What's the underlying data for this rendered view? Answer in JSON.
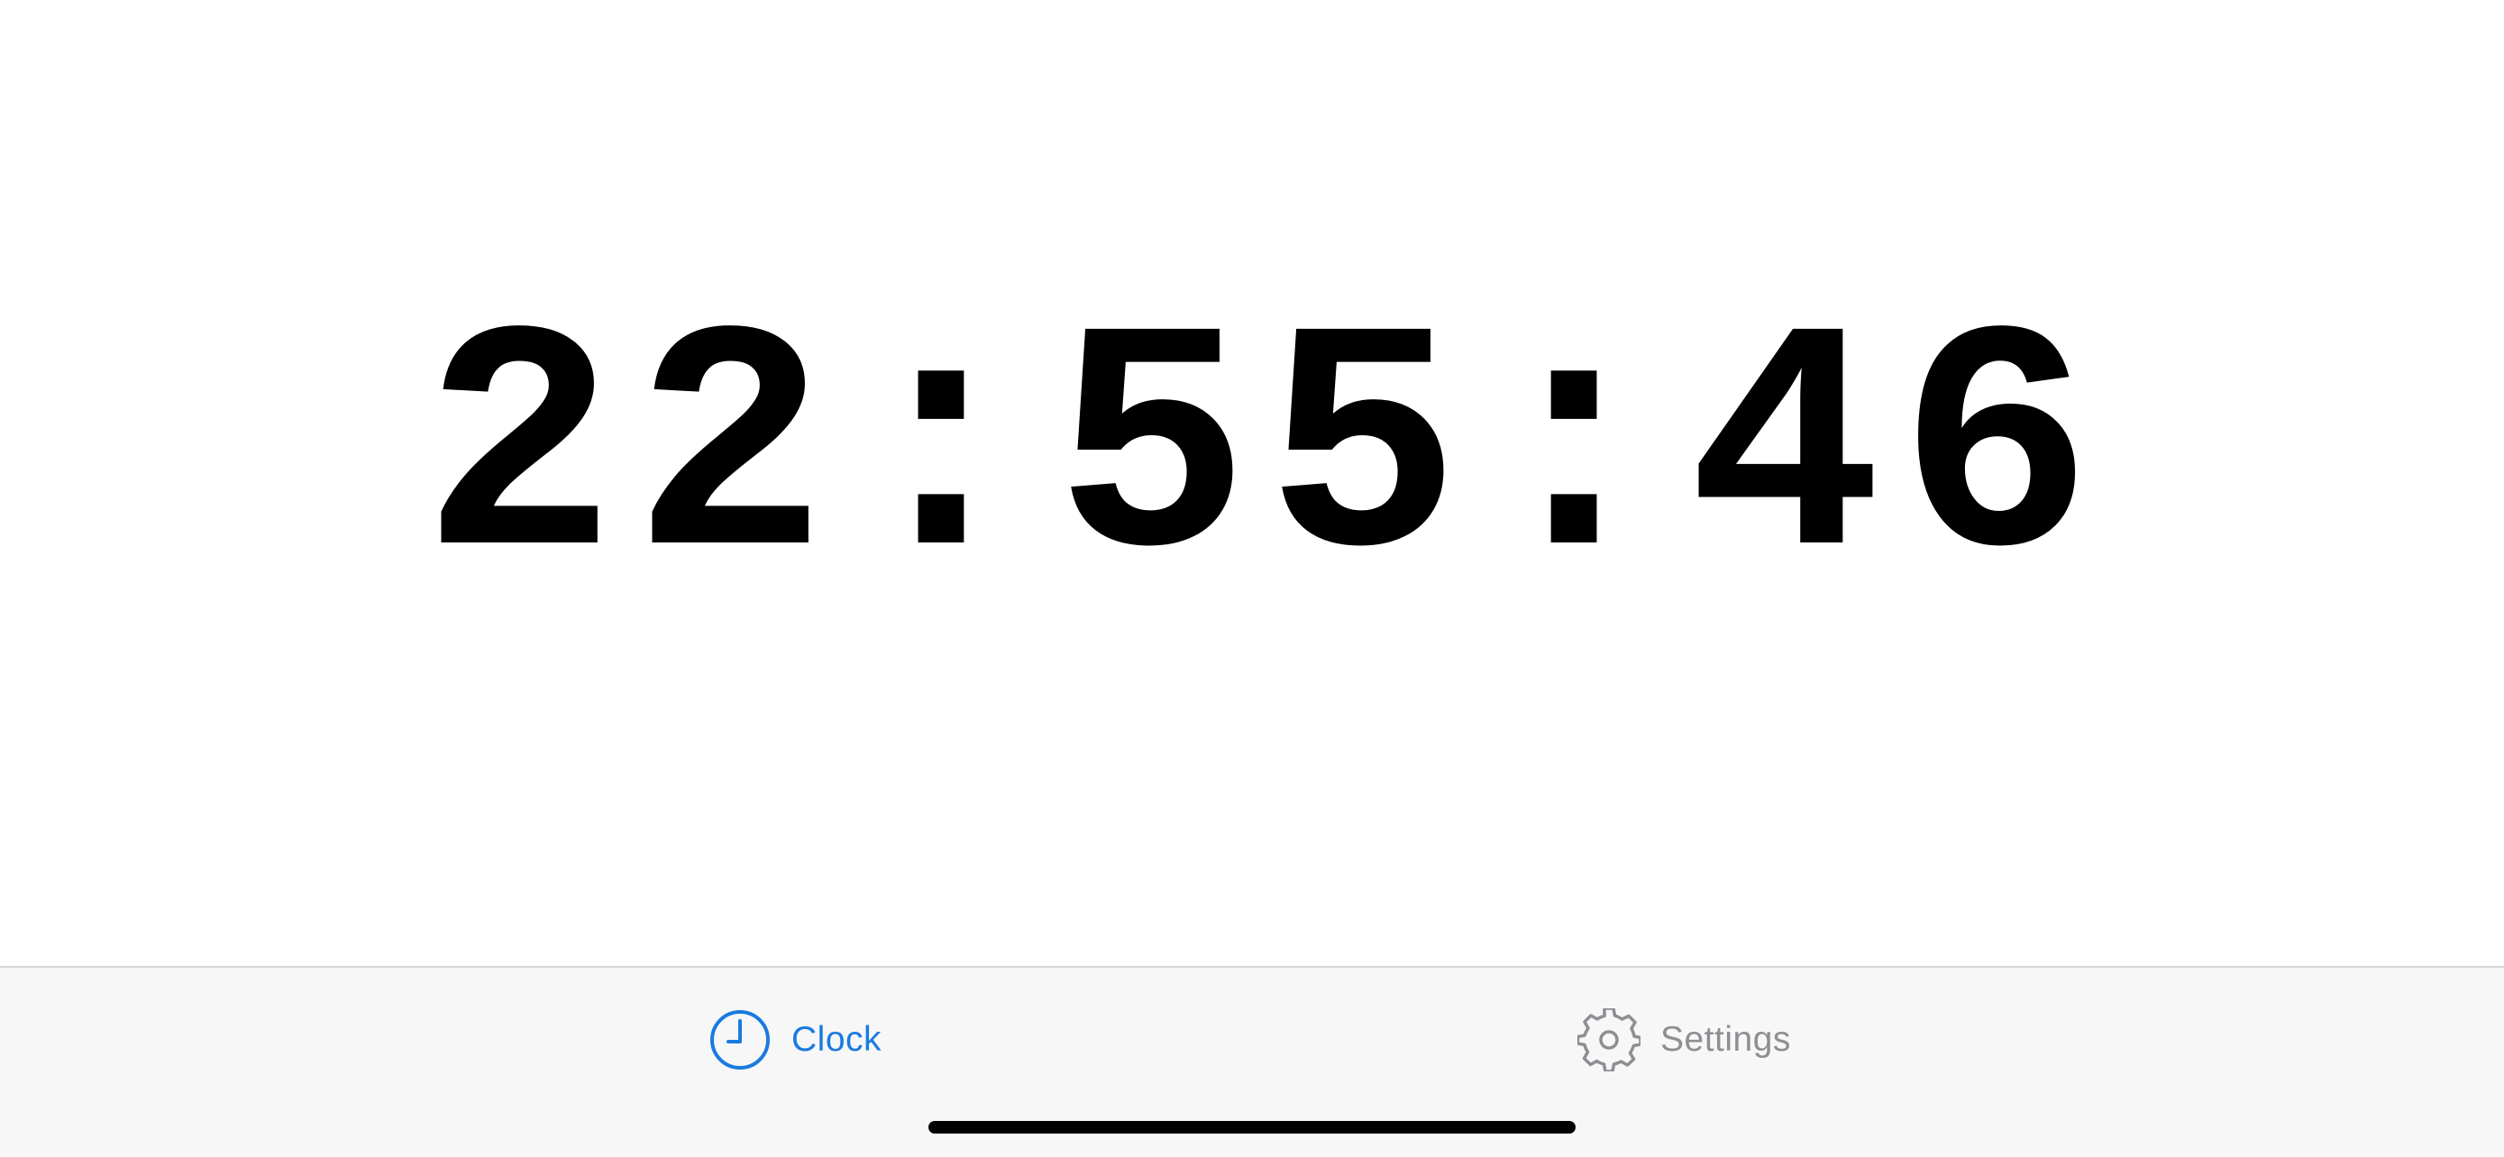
{
  "clock": {
    "time": "22:55:46"
  },
  "tabbar": {
    "tabs": [
      {
        "label": "Clock",
        "icon": "clock-icon",
        "selected": true,
        "color": "#1a7be0"
      },
      {
        "label": "Settings",
        "icon": "gear-icon",
        "selected": false,
        "color": "#8e8e93"
      }
    ]
  },
  "colors": {
    "accent": "#1a7be0",
    "inactive": "#8e8e93",
    "tabbar_background": "#f7f7f7",
    "text": "#000000"
  }
}
